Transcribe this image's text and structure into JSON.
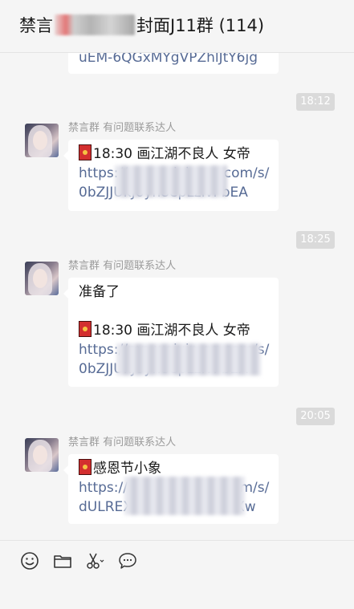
{
  "header": {
    "title_prefix": "禁言",
    "title_suffix": "封面J11群 (114)"
  },
  "messages": {
    "partial_link": "uEM-6QGxMYgVPZhlJtY6jg",
    "t1": "18:12",
    "m1": {
      "sender": "禁言群 有问题联系达人",
      "title": "18:30 画江湖不良人 女帝",
      "link1": "https://mp.weixin.qq.com/s/",
      "link2": "0bZJJUkJ6yn8epLzlvPbEA"
    },
    "t2": "18:25",
    "m2": {
      "sender": "禁言群 有问题联系达人",
      "intro": "准备了",
      "title": "18:30 画江湖不良人 女帝",
      "link1": "https://mp.weixin.qq.com/s/",
      "link2": "0bZJJUkJ6yn8epLzlvPbEA"
    },
    "t3": "20:05",
    "m3": {
      "sender": "禁言群 有问题联系达人",
      "title": "感恩节小象",
      "link1": "https://mp.weixin.qq.com/s/",
      "link2": "dULREXXXX5RTYTL9TTXw"
    }
  },
  "toolbar": {
    "icons": [
      "emoji-icon",
      "folder-icon",
      "scissors-icon",
      "chat-bubble-icon"
    ]
  }
}
